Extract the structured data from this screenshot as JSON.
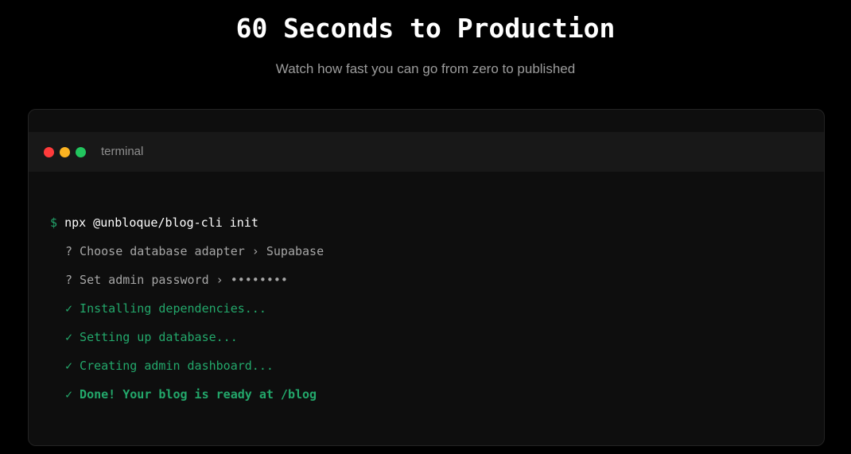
{
  "hero": {
    "title": "60 Seconds to Production",
    "subtitle": "Watch how fast you can go from zero to published"
  },
  "terminal": {
    "label": "terminal",
    "dots": [
      "red",
      "yellow",
      "green"
    ],
    "prompt": "$",
    "command": "npx @unbloque/blog-cli init",
    "lines": [
      {
        "kind": "question",
        "text": "? Choose database adapter › Supabase"
      },
      {
        "kind": "question",
        "text": "? Set admin password › ••••••••"
      },
      {
        "kind": "ok",
        "text": "✓ Installing dependencies..."
      },
      {
        "kind": "ok",
        "text": "✓ Setting up database..."
      },
      {
        "kind": "ok",
        "text": "✓ Creating admin dashboard..."
      },
      {
        "kind": "done",
        "text": "✓ Done! Your blog is ready at /blog"
      }
    ]
  },
  "colors": {
    "background": "#000000",
    "window": "#0e0e0e",
    "titlebar": "#181818",
    "success": "#23a86b",
    "dot_red": "#ff3b3b",
    "dot_yellow": "#fbb321",
    "dot_green": "#22c55e"
  }
}
